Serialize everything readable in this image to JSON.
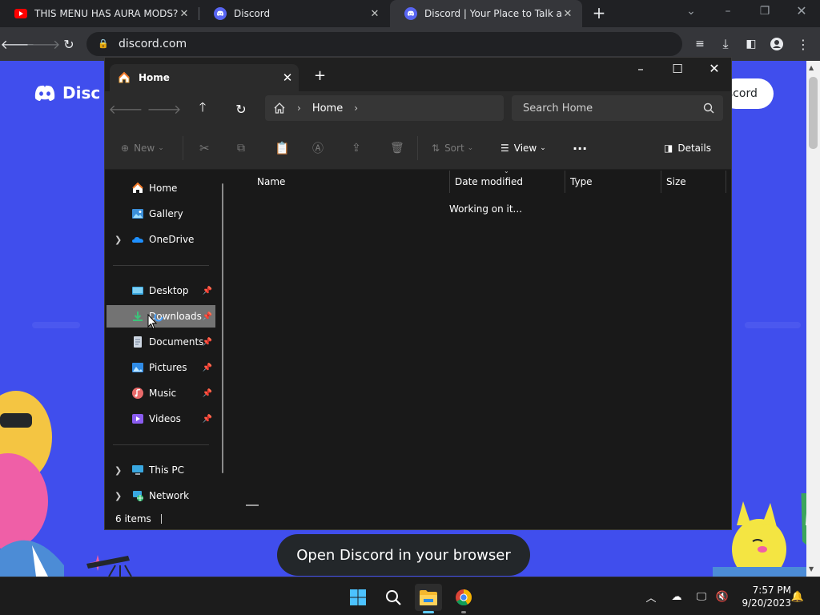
{
  "browser": {
    "tabs": [
      {
        "title": "THIS MENU HAS AURA MODS??",
        "favicon": "youtube-icon"
      },
      {
        "title": "Discord",
        "favicon": "discord-icon"
      },
      {
        "title": "Discord | Your Place to Talk and H",
        "favicon": "discord-icon",
        "active": true
      }
    ],
    "url": "discord.com"
  },
  "discord_page": {
    "logo_text": "Disc",
    "login_button": "iscord",
    "open_browser_button": "Open Discord in your browser"
  },
  "explorer": {
    "tab_title": "Home",
    "breadcrumb": "Home",
    "search_placeholder": "Search Home",
    "commands": {
      "new": "New",
      "sort": "Sort",
      "view": "View",
      "details": "Details"
    },
    "nav_top": [
      {
        "label": "Home",
        "icon": "home-icon"
      },
      {
        "label": "Gallery",
        "icon": "gallery-icon"
      },
      {
        "label": "OneDrive",
        "icon": "onedrive-icon"
      }
    ],
    "nav_pinned": [
      {
        "label": "Desktop",
        "icon": "desktop-icon"
      },
      {
        "label": "Downloads",
        "icon": "download-icon"
      },
      {
        "label": "Documents",
        "icon": "documents-icon"
      },
      {
        "label": "Pictures",
        "icon": "pictures-icon"
      },
      {
        "label": "Music",
        "icon": "music-icon"
      },
      {
        "label": "Videos",
        "icon": "videos-icon"
      }
    ],
    "nav_bottom": [
      {
        "label": "This PC",
        "icon": "pc-icon"
      },
      {
        "label": "Network",
        "icon": "network-icon"
      }
    ],
    "columns": [
      "Name",
      "Date modified",
      "Type",
      "Size"
    ],
    "status_message": "Working on it...",
    "item_count": "6 items"
  },
  "taskbar": {
    "time": "7:57 PM",
    "date": "9/20/2023"
  },
  "colors": {
    "discord_blurple": "#404eed",
    "explorer_bg": "#191919",
    "accent": "#60cdff"
  }
}
